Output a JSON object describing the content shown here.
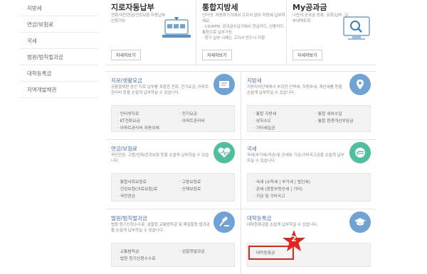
{
  "sidebar": {
    "items": [
      {
        "label": "지방세"
      },
      {
        "label": "연금/보험료"
      },
      {
        "label": "국세"
      },
      {
        "label": "범원/범칙벌과금"
      },
      {
        "label": "대학등록금"
      },
      {
        "label": "지역개발채권"
      }
    ]
  },
  "top_cards": [
    {
      "title": "지로자동납부",
      "desc": "전화/국민연금/건강보험 자동납부 신청가능",
      "button": "자세히보기"
    },
    {
      "title": "통합지방세",
      "desc": "인터넷, 자동화기기에서 고지서 없이 지방세 납부하세요.\n· CD/ATM, 공과금수납기에서 현금카드, 신용카드, 통장으로 납부가능\n· 창구 납부 시에는 고지서 반드시 지참",
      "button": "자세히보기"
    },
    {
      "title": "My공과금",
      "desc": "나만의 공과금 등록, 조회/납부, 납부내역조회",
      "button": "자세히보기"
    }
  ],
  "categories": [
    {
      "title": "지로/생활요금",
      "desc": "금융결제원 승인 지로 납부를 포함한 전화, 전기요금, 아파트관리비 등을 손쉽게 납부하실 수 있습니다.",
      "items": [
        "인터넷지로",
        "전기요금",
        "KT전화요금",
        "아파트관리비",
        "아파트관리비 자동이체"
      ]
    },
    {
      "title": "지방세",
      "desc": "지방자치단체에서 부과한 인력세, 자동차세, 재산세를 등을 손쉽게 납부하실 수 있습니다.",
      "items": [
        "통합 지방세",
        "통합 세외수입",
        "상하수도",
        "통합 환경개선부담금",
        "기타세입금"
      ]
    },
    {
      "title": "연금/보험료",
      "desc": "국민연금, 고용/산재/건강보험 등을 손쉽게 납부하실 수 있습니다.",
      "items": [
        "통합사회보험료",
        "고용보험료",
        "건강보험(의료보험)료",
        "산재보험료",
        "국민연금"
      ]
    },
    {
      "title": "국세",
      "desc": "국세(부가세)자금)및 관세와 기금/기타국고금을 손쉽게 납부하실 수 있습니다.",
      "items": [
        "국세 (소득세 | 부가세 | 법인세)",
        "관세 (종합부동산세 | 기타)",
        "기금 및 기타국고"
      ]
    },
    {
      "title": "벌원/범칙벌과금",
      "desc": "법원 등기신청수수료, 검찰청 교통범칙금 및 매검찰청 벌과금을 손쉽게 납부하실 수 있습니다.",
      "items": [
        "교통범칙금",
        "검찰청벌과금",
        "법원 등기신청수수료"
      ]
    },
    {
      "title": "대학등록금",
      "desc": "대학등록금을 손쉽게 납부하실 수 있습니다.",
      "items": [
        "대학등록금"
      ]
    }
  ],
  "annotation": {
    "number": "2"
  },
  "colors": {
    "accent": "#4a73b6",
    "icon_blue": "#6fa3d6",
    "icon_green": "#4fbf9f",
    "annotation_red": "#e5241b"
  }
}
